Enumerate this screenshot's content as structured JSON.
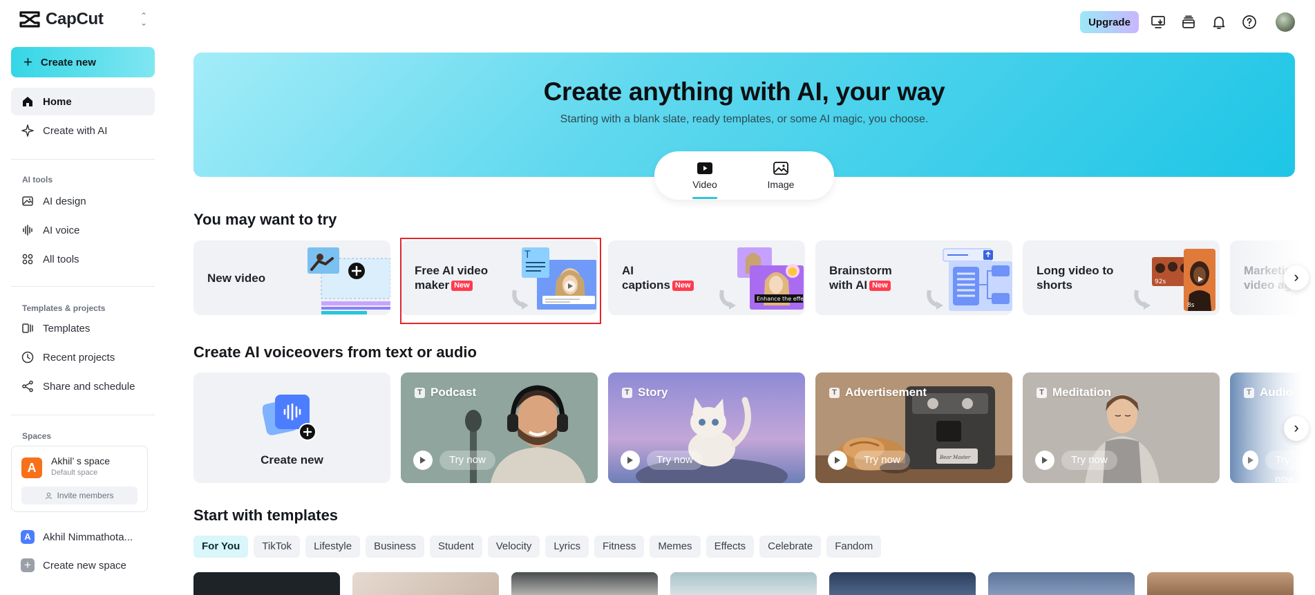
{
  "app": {
    "name": "CapCut"
  },
  "sidebar": {
    "create_new": "Create new",
    "primary": [
      {
        "label": "Home",
        "icon": "home-icon"
      },
      {
        "label": "Create with AI",
        "icon": "sparkle-icon"
      }
    ],
    "ai_tools_heading": "AI tools",
    "ai_tools": [
      {
        "label": "AI design",
        "icon": "image-edit-icon"
      },
      {
        "label": "AI voice",
        "icon": "waveform-icon"
      },
      {
        "label": "All tools",
        "icon": "grid-icon"
      }
    ],
    "templates_heading": "Templates & projects",
    "templates": [
      {
        "label": "Templates",
        "icon": "template-icon"
      },
      {
        "label": "Recent projects",
        "icon": "clock-icon"
      },
      {
        "label": "Share and schedule",
        "icon": "share-icon"
      }
    ],
    "spaces_heading": "Spaces",
    "space": {
      "avatar": "A",
      "name": "Akhil’ s space",
      "subtitle": "Default space",
      "invite": "Invite members"
    },
    "account": {
      "avatar": "A",
      "name": "Akhil Nimmathota..."
    },
    "create_space": "Create new space"
  },
  "topbar": {
    "upgrade": "Upgrade"
  },
  "hero": {
    "title": "Create anything with AI, your way",
    "subtitle": "Starting with a blank slate, ready templates, or some AI magic, you choose.",
    "tabs": [
      "Video",
      "Image"
    ],
    "active_tab": "Video"
  },
  "try_section": {
    "title": "You may want to try",
    "cards": [
      {
        "line1": "New video",
        "line2": "",
        "new": false
      },
      {
        "line1": "Free AI video",
        "line2": "maker",
        "new": true
      },
      {
        "line1": "AI",
        "line2": "captions",
        "new": true
      },
      {
        "line1": "Brainstorm",
        "line2": "with AI",
        "new": true
      },
      {
        "line1": "Long video to",
        "line2": "shorts",
        "new": false
      },
      {
        "line1": "Marketing",
        "line2": "video ag",
        "new": false
      }
    ],
    "new_badge": "New",
    "caption_overlay": "Enhance the effects",
    "duration_long": "92s",
    "duration_short": "8s"
  },
  "voice_section": {
    "title": "Create AI voiceovers from text or audio",
    "create_new": "Create new",
    "try_now": "Try now",
    "cards": [
      {
        "label": "Podcast",
        "bg": "#8fa39c"
      },
      {
        "label": "Story",
        "bg": "#8b86cf"
      },
      {
        "label": "Advertisement",
        "bg": "#a88a6c"
      },
      {
        "label": "Meditation",
        "bg": "#b7b2ae"
      },
      {
        "label": "Audio",
        "bg": "#6f8fb8"
      }
    ],
    "espresso_brand": "Bear Master"
  },
  "templates_section": {
    "title": "Start with templates",
    "chips": [
      "For You",
      "TikTok",
      "Lifestyle",
      "Business",
      "Student",
      "Velocity",
      "Lyrics",
      "Fitness",
      "Memes",
      "Effects",
      "Celebrate",
      "Fandom"
    ],
    "active_chip": "For You"
  },
  "colors": {
    "accent": "#2ec5dd",
    "new_badge": "#ff3b4f",
    "highlight_border": "#e3262c"
  }
}
